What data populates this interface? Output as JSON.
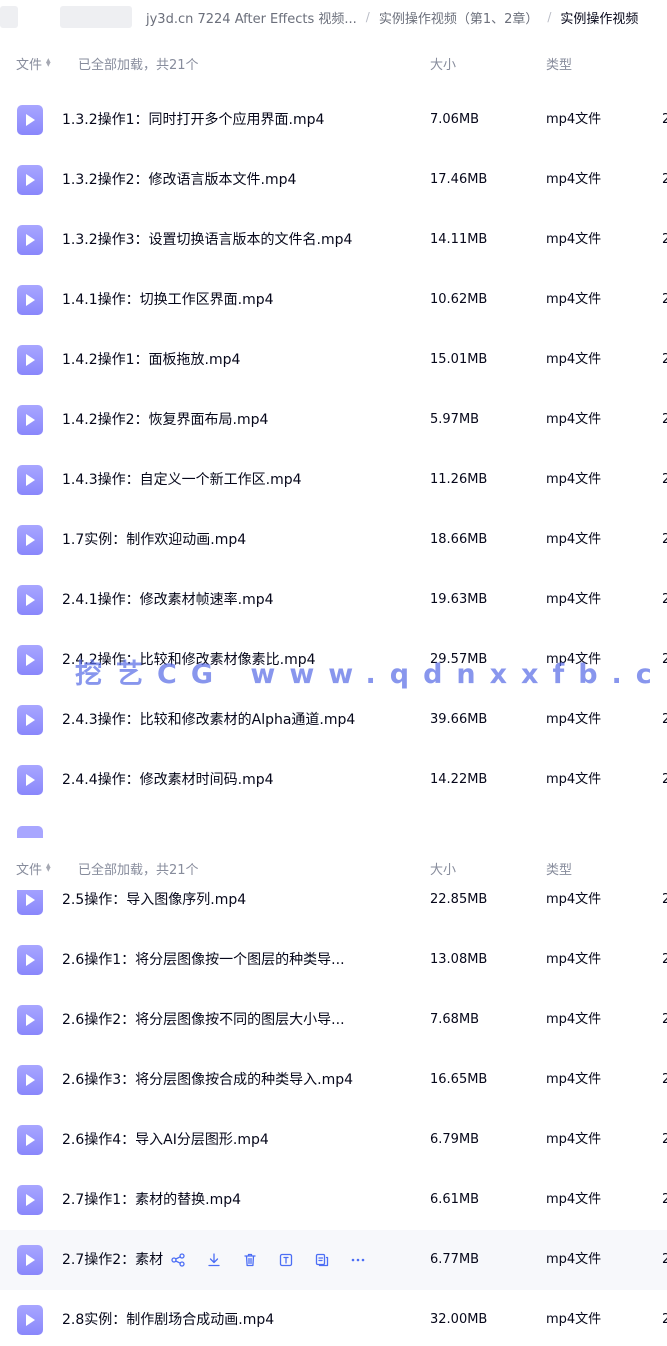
{
  "breadcrumb": {
    "items": [
      "jy3d.cn 7224 After Effects 视频...",
      "实例操作视频（第1、2章）",
      "实例操作视频"
    ],
    "separator": "/"
  },
  "header": {
    "file_label": "文件",
    "loaded_text": "已全部加载，共21个",
    "size_label": "大小",
    "type_label": "类型"
  },
  "files_top": [
    {
      "name": "1.3.2操作1：同时打开多个应用界面.mp4",
      "size": "7.06MB",
      "type": "mp4文件",
      "date": "2"
    },
    {
      "name": "1.3.2操作2：修改语言版本文件.mp4",
      "size": "17.46MB",
      "type": "mp4文件",
      "date": "2"
    },
    {
      "name": "1.3.2操作3：设置切换语言版本的文件名.mp4",
      "size": "14.11MB",
      "type": "mp4文件",
      "date": "2"
    },
    {
      "name": "1.4.1操作：切换工作区界面.mp4",
      "size": "10.62MB",
      "type": "mp4文件",
      "date": "2"
    },
    {
      "name": "1.4.2操作1：面板拖放.mp4",
      "size": "15.01MB",
      "type": "mp4文件",
      "date": "2"
    },
    {
      "name": "1.4.2操作2：恢复界面布局.mp4",
      "size": "5.97MB",
      "type": "mp4文件",
      "date": "2"
    },
    {
      "name": "1.4.3操作：自定义一个新工作区.mp4",
      "size": "11.26MB",
      "type": "mp4文件",
      "date": "2"
    },
    {
      "name": "1.7实例：制作欢迎动画.mp4",
      "size": "18.66MB",
      "type": "mp4文件",
      "date": "2"
    },
    {
      "name": "2.4.1操作：修改素材帧速率.mp4",
      "size": "19.63MB",
      "type": "mp4文件",
      "date": "2"
    },
    {
      "name": "2.4.2操作：比较和修改素材像素比.mp4",
      "size": "29.57MB",
      "type": "mp4文件",
      "date": "2"
    },
    {
      "name": "2.4.3操作：比较和修改素材的Alpha通道.mp4",
      "size": "39.66MB",
      "type": "mp4文件",
      "date": "2"
    },
    {
      "name": "2.4.4操作：修改素材时间码.mp4",
      "size": "14.22MB",
      "type": "mp4文件",
      "date": "2"
    }
  ],
  "files_bottom": [
    {
      "name": "2.5操作：导入图像序列.mp4",
      "size": "22.85MB",
      "type": "mp4文件",
      "date": "2"
    },
    {
      "name": "2.6操作1：将分层图像按一个图层的种类导...",
      "size": "13.08MB",
      "type": "mp4文件",
      "date": "2"
    },
    {
      "name": "2.6操作2：将分层图像按不同的图层大小导...",
      "size": "7.68MB",
      "type": "mp4文件",
      "date": "2"
    },
    {
      "name": "2.6操作3：将分层图像按合成的种类导入.mp4",
      "size": "16.65MB",
      "type": "mp4文件",
      "date": "2"
    },
    {
      "name": "2.6操作4：导入AI分层图形.mp4",
      "size": "6.79MB",
      "type": "mp4文件",
      "date": "2"
    },
    {
      "name": "2.7操作1：素材的替换.mp4",
      "size": "6.61MB",
      "type": "mp4文件",
      "date": "2"
    },
    {
      "name": "2.7操作2：素材",
      "size": "6.77MB",
      "type": "mp4文件",
      "date": "2",
      "hovered": true
    },
    {
      "name": "2.8实例：制作剧场合成动画.mp4",
      "size": "32.00MB",
      "type": "mp4文件",
      "date": "2"
    }
  ],
  "row_actions": [
    "share-icon",
    "download-icon",
    "delete-icon",
    "rename-icon",
    "copy-icon",
    "more-icon"
  ],
  "watermark": "挖艺CG  www.qdnxxfb.cn",
  "colors": {
    "file_icon": "#9a98fd",
    "hover_row": "#f7f8fb",
    "action_icon": "#4c6ef5",
    "watermark": "#5a6ee6"
  }
}
